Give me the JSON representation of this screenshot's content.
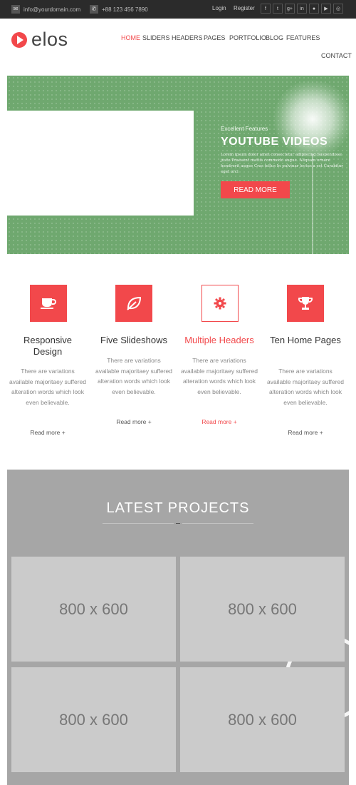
{
  "topbar": {
    "email": "info@yourdomain.com",
    "phone": "+88 123 456 7890",
    "login": "Login",
    "register": "Register",
    "email_icon": "envelope-icon",
    "phone_icon": "phone-icon",
    "socials": [
      {
        "name": "facebook-icon",
        "glyph": "f"
      },
      {
        "name": "twitter-icon",
        "glyph": "t"
      },
      {
        "name": "googleplus-icon",
        "glyph": "g+"
      },
      {
        "name": "linkedin-icon",
        "glyph": "in"
      },
      {
        "name": "flickr-icon",
        "glyph": "●"
      },
      {
        "name": "youtube-icon",
        "glyph": "▶"
      },
      {
        "name": "dribbble-icon",
        "glyph": "◎"
      }
    ]
  },
  "header": {
    "logo_text": "elos",
    "nav": [
      "HOME",
      "SLIDERS",
      "HEADERS",
      "PAGES",
      "PORTFOLIO",
      "BLOG",
      "FEATURES",
      "CONTACT"
    ],
    "active_nav": "HOME"
  },
  "hero": {
    "kicker": "Excellent Features",
    "title": "YOUTUBE VIDEOS",
    "description": "Lorem ipsum dolor amet consectetur adipiscing Suspendisse justo Praesent mattis commodo augue. Aliquam ornare hendrerit augue Cras tellus In pulvinar lectus a est Curabitur eget orci",
    "button": "READ MORE"
  },
  "features": [
    {
      "icon": "coffee-cup-icon",
      "title": "Responsive Design",
      "description": "There are variations available majoritaey suffered alteration words which look even believable.",
      "more": "Read more +"
    },
    {
      "icon": "leaf-icon",
      "title": "Five Slideshows",
      "description": "There are variations available majoritaey suffered alteration words which look even believable.",
      "more": "Read more +"
    },
    {
      "icon": "gear-icon",
      "title": "Multiple Headers",
      "description": "There are variations available majoritaey suffered alteration words which look even believable.",
      "more": "Read more +"
    },
    {
      "icon": "trophy-icon",
      "title": "Ten Home Pages",
      "description": "There are variations available majoritaey suffered alteration words which look even believable.",
      "more": "Read more +"
    }
  ],
  "projects": {
    "heading": "LATEST PROJECTS",
    "thumbnails": [
      "800 x 600",
      "800 x 600",
      "800 x 600",
      "800 x 600"
    ]
  },
  "colors": {
    "accent": "#f2484b",
    "topbar": "#2b2b2b",
    "hero_green": "#6fa86f",
    "projects_bg": "#a6a6a6",
    "thumb": "#cbcbcb"
  }
}
